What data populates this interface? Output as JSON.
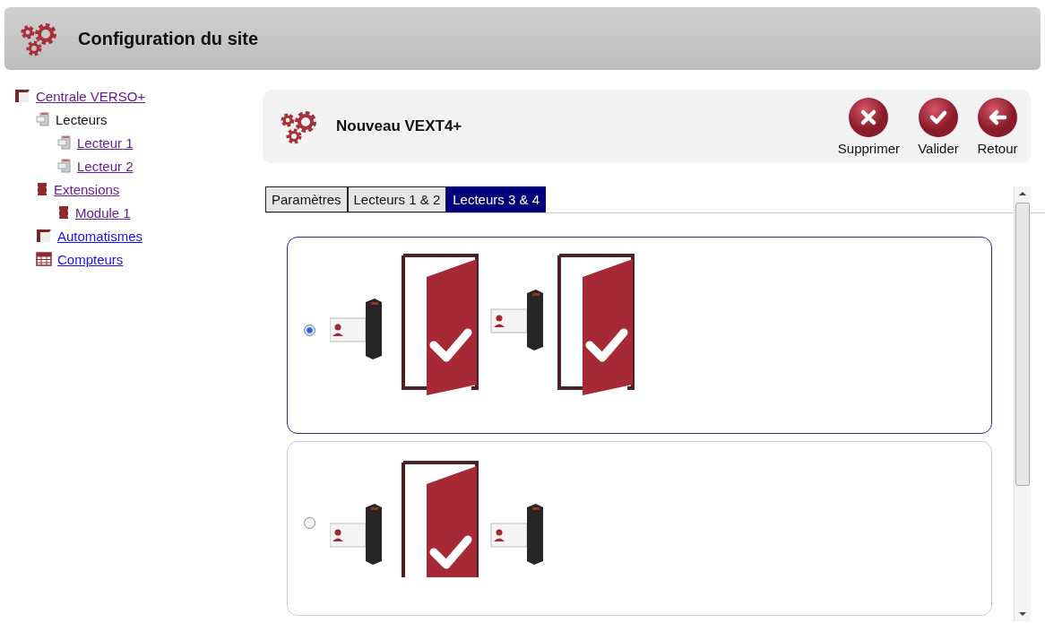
{
  "window": {
    "title": "Configuration du site"
  },
  "tree": [
    {
      "label": "Centrale VERSO+",
      "kind": "folder",
      "link": true,
      "visited": true,
      "children": [
        {
          "label": "Lecteurs",
          "kind": "reader",
          "link": false,
          "children": [
            {
              "label": "Lecteur 1",
              "kind": "reader",
              "link": true,
              "visited": true
            },
            {
              "label": "Lecteur 2",
              "kind": "reader",
              "link": true,
              "visited": true
            }
          ]
        },
        {
          "label": "Extensions",
          "kind": "module",
          "link": true,
          "visited": true,
          "children": [
            {
              "label": "Module 1",
              "kind": "module",
              "link": true,
              "visited": true
            }
          ]
        },
        {
          "label": "Automatismes",
          "kind": "folder",
          "link": true,
          "visited": false
        },
        {
          "label": "Compteurs",
          "kind": "table",
          "link": true,
          "visited": false
        }
      ]
    }
  ],
  "panel": {
    "title": "Nouveau VEXT4+",
    "actions": [
      {
        "label": "Supprimer",
        "kind": "delete"
      },
      {
        "label": "Valider",
        "kind": "validate"
      },
      {
        "label": "Retour",
        "kind": "back"
      }
    ]
  },
  "tabs": [
    {
      "label": "Paramètres",
      "selected": false
    },
    {
      "label": "Lecteurs 1 & 2",
      "selected": false
    },
    {
      "label": "Lecteurs 3 & 4",
      "selected": true
    }
  ],
  "options": [
    {
      "kind": "two-doors",
      "selected": true
    },
    {
      "kind": "shared-door",
      "selected": false
    }
  ]
}
